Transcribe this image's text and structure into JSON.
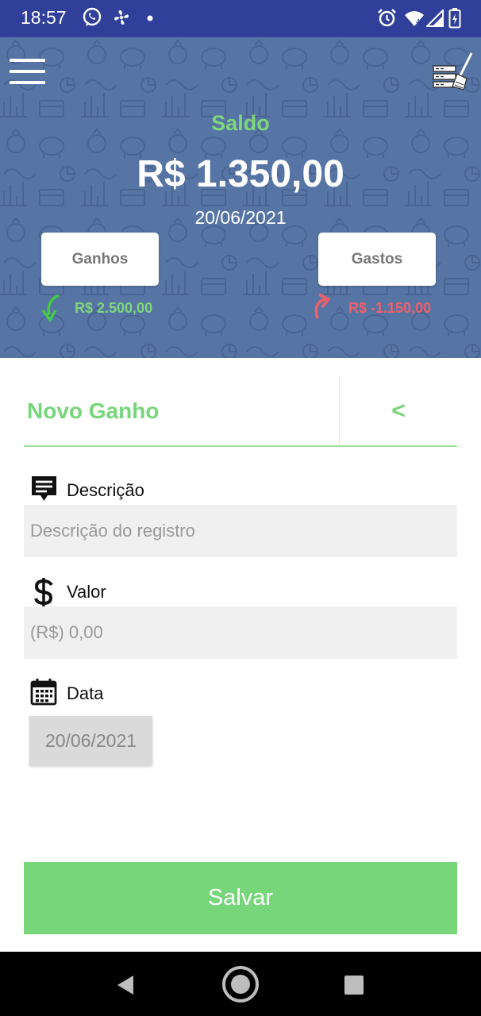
{
  "status_bar": {
    "time": "18:57",
    "icons": [
      "whatsapp-icon",
      "fan-icon",
      "dot-icon",
      "alarm-icon",
      "wifi-icon",
      "signal-icon",
      "battery-icon"
    ]
  },
  "header": {
    "menu_icon": "hamburger-menu-icon",
    "clear_icon": "broom-clean-icon",
    "balance_label": "Saldo",
    "balance_value": "R$ 1.350,00",
    "date": "20/06/2021",
    "income_button": "Ganhos",
    "expense_button": "Gastos",
    "income_total": "R$ 2.500,00",
    "expense_total": "R$ -1.150,00"
  },
  "form": {
    "title": "Novo Ganho",
    "back_label": "<",
    "description_label": "Descrição",
    "description_placeholder": "Descrição do registro",
    "value_label": "Valor",
    "value_placeholder": "(R$) 0,00",
    "date_label": "Data",
    "date_value": "20/06/2021",
    "save_label": "Salvar"
  },
  "colors": {
    "accent_green": "#77d57a",
    "header_blue": "#5675a4",
    "status_bar": "#2f3f9a",
    "income_green": "#7fd67a",
    "expense_red": "#f0606a"
  },
  "nav_bar": [
    "back-triangle-icon",
    "home-circle-icon",
    "recents-square-icon"
  ]
}
